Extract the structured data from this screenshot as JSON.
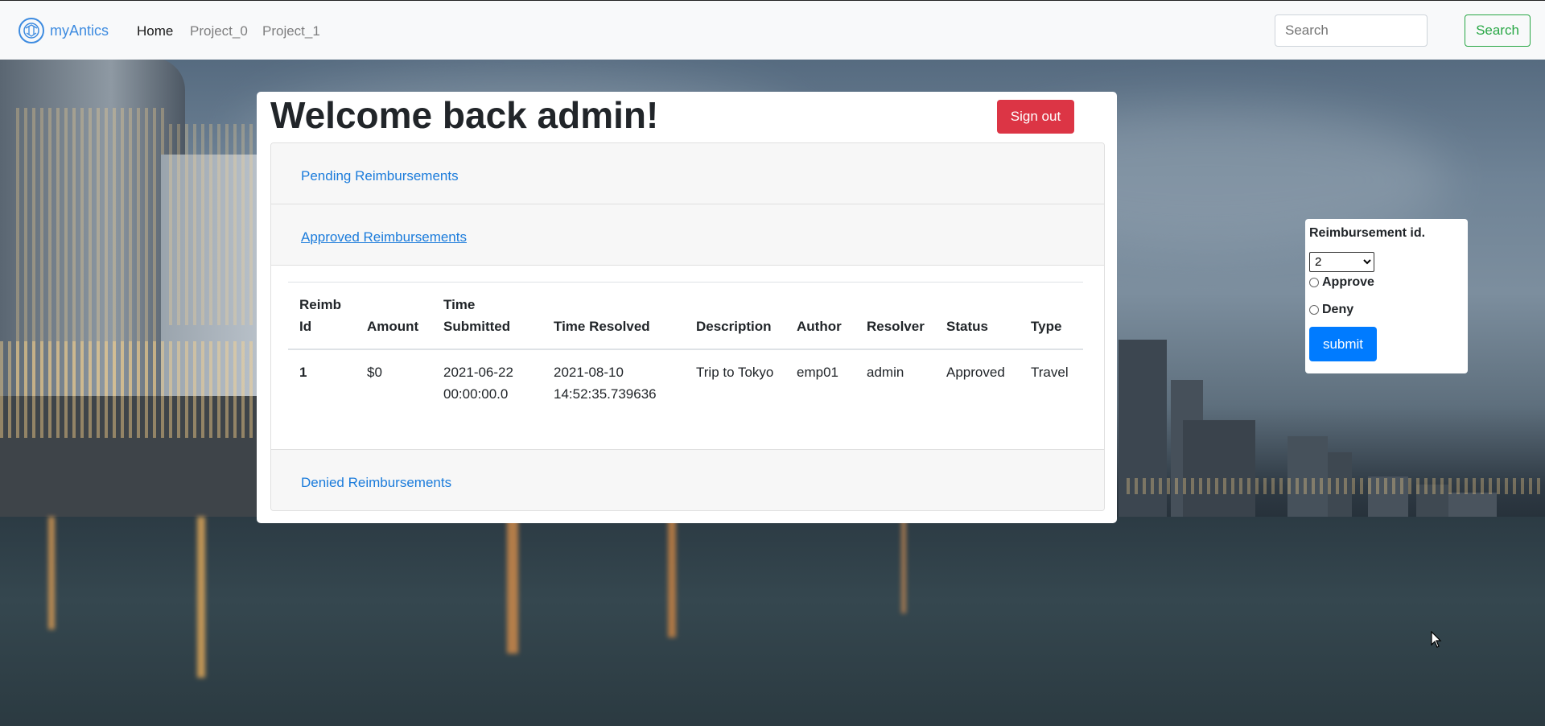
{
  "navbar": {
    "brand": "myAntics",
    "links": [
      {
        "label": "Home",
        "active": true
      },
      {
        "label": "Project_0",
        "active": false
      },
      {
        "label": "Project_1",
        "active": false
      }
    ],
    "search_placeholder": "Search",
    "search_button": "Search"
  },
  "main": {
    "welcome": "Welcome back admin!",
    "signout": "Sign out",
    "sections": {
      "pending": "Pending Reimbursements",
      "approved": "Approved Reimbursements",
      "denied": "Denied Reimbursements"
    },
    "table": {
      "headers": [
        "Reimb Id",
        "Amount",
        "Time Submitted",
        "Time Resolved",
        "Description",
        "Author",
        "Resolver",
        "Status",
        "Type"
      ],
      "rows": [
        {
          "id": "1",
          "amount": "$0",
          "submitted": "2021-06-22 00:00:00.0",
          "resolved": "2021-08-10 14:52:35.739636",
          "description": "Trip to Tokyo",
          "author": "emp01",
          "resolver": "admin",
          "status": "Approved",
          "type": "Travel"
        }
      ]
    }
  },
  "side_form": {
    "label": "Reimbursement id.",
    "selected_id": "2",
    "options": [
      "Approve",
      "Deny"
    ],
    "submit": "submit"
  },
  "colors": {
    "link": "#1a7bdb",
    "danger": "#dc3545",
    "primary": "#007bff",
    "success": "#28a745"
  }
}
